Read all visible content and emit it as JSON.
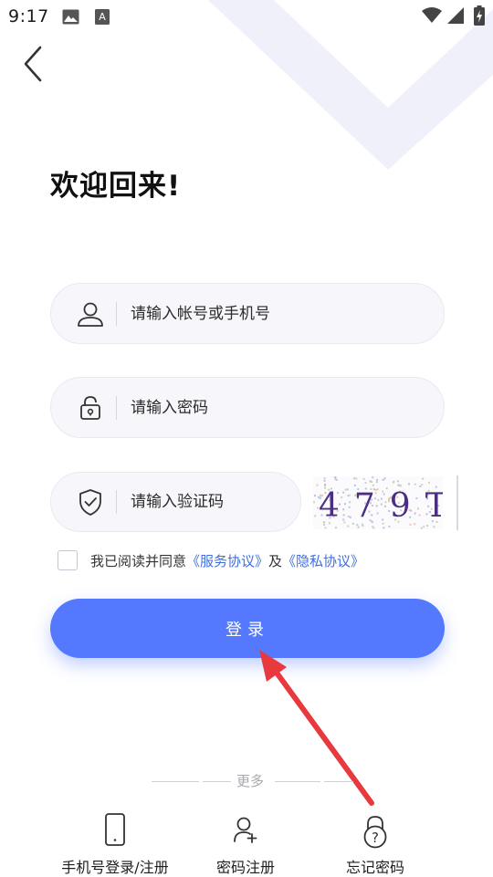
{
  "status_bar": {
    "time": "9:17"
  },
  "header": {
    "back_icon": "chevron-left-icon"
  },
  "title": "欢迎回来!",
  "form": {
    "account_placeholder": "请输入帐号或手机号",
    "password_placeholder": "请输入密码",
    "captcha_placeholder": "请输入验证码",
    "captcha_text": "479T"
  },
  "agreement": {
    "prefix": "我已阅读并同意",
    "service_link": "《服务协议》",
    "conjunction": "及",
    "privacy_link": "《隐私协议》",
    "checked": false
  },
  "login_button_label": "登录",
  "more": {
    "label": "更多",
    "items": [
      {
        "label": "手机号登录/注册",
        "icon": "mobile-phone-icon"
      },
      {
        "label": "密码注册",
        "icon": "add-user-icon"
      },
      {
        "label": "忘记密码",
        "icon": "lock-question-icon"
      }
    ]
  },
  "colors": {
    "accent": "#5479ff",
    "link": "#3f6fdc",
    "field_bg": "#f6f6fb",
    "arrow": "#e8393f"
  }
}
